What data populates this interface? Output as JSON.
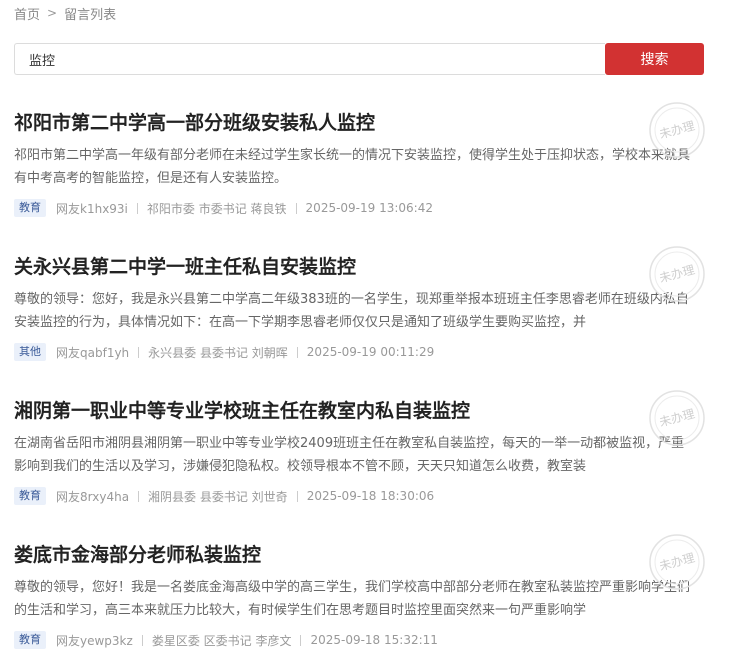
{
  "breadcrumb": {
    "home": "首页",
    "separator": ">",
    "current": "留言列表"
  },
  "search": {
    "value": "监控",
    "button_label": "搜索"
  },
  "stamp_label": "未办理",
  "colors": {
    "accent": "#d23232",
    "badge_bg": "#eaf0fa",
    "badge_text": "#3a5a98"
  },
  "messages": [
    {
      "title": "祁阳市第二中学高一部分班级安装私人监控",
      "summary": "祁阳市第二中学高一年级有部分老师在未经过学生家长统一的情况下安装监控，使得学生处于压抑状态，学校本来就具有中考高考的智能监控，但是还有人安装监控。",
      "category": "教育",
      "user": "网友k1hx93i",
      "recipient": "祁阳市委 市委书记 蒋良铁",
      "time": "2025-09-19 13:06:42",
      "status": "未办理"
    },
    {
      "title": "关永兴县第二中学一班主任私自安装监控",
      "summary": "尊敬的领导：您好，我是永兴县第二中学高二年级383班的一名学生，现郑重举报本班班主任李思睿老师在班级内私自安装监控的行为，具体情况如下：在高一下学期李思睿老师仅仅只是通知了班级学生要购买监控，并",
      "category": "其他",
      "user": "网友qabf1yh",
      "recipient": "永兴县委 县委书记 刘朝晖",
      "time": "2025-09-19 00:11:29",
      "status": "未办理"
    },
    {
      "title": "湘阴第一职业中等专业学校班主任在教室内私自装监控",
      "summary": "在湖南省岳阳市湘阴县湘阴第一职业中等专业学校2409班班主任在教室私自装监控，每天的一举一动都被监视，严重影响到我们的生活以及学习，涉嫌侵犯隐私权。校领导根本不管不顾，天天只知道怎么收费，教室装",
      "category": "教育",
      "user": "网友8rxy4ha",
      "recipient": "湘阴县委 县委书记 刘世奇",
      "time": "2025-09-18 18:30:06",
      "status": "未办理"
    },
    {
      "title": "娄底市金海部分老师私装监控",
      "summary": "尊敬的领导，您好！我是一名娄底金海高级中学的高三学生，我们学校高中部部分老师在教室私装监控严重影响学生们的生活和学习，高三本来就压力比较大，有时候学生们在思考题目时监控里面突然来一句严重影响学",
      "category": "教育",
      "user": "网友yewp3kz",
      "recipient": "娄星区委 区委书记 李彦文",
      "time": "2025-09-18 15:32:11",
      "status": "未办理"
    }
  ]
}
